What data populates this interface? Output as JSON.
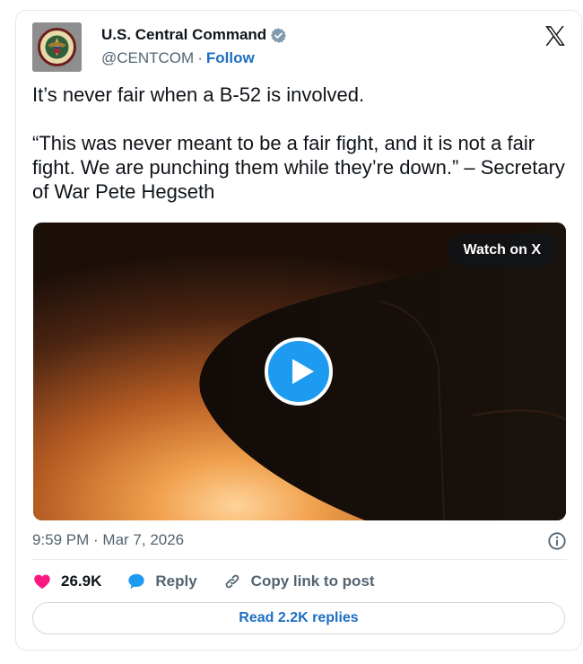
{
  "author": {
    "display_name": "U.S. Central Command",
    "handle": "@CENTCOM",
    "separator": "·",
    "follow_label": "Follow"
  },
  "tweet": {
    "line1": "It’s never fair when a B-52 is involved.",
    "line2": "“This was never meant to be a fair fight, and it is not a fair fight. We are punching them while they’re down.” – Secretary of War Pete Hegseth"
  },
  "media": {
    "watch_label": "Watch on X"
  },
  "timestamp": "9:59 PM · Mar 7, 2026",
  "actions": {
    "likes": "26.9K",
    "reply_label": "Reply",
    "copy_label": "Copy link to post"
  },
  "read_replies_label": "Read 2.2K replies",
  "icons": {
    "verified": "verified-badge-icon",
    "x_logo": "x-logo-icon",
    "play": "play-icon",
    "info": "info-icon",
    "like": "heart-icon",
    "reply": "speech-bubble-icon",
    "copy": "link-icon"
  },
  "colors": {
    "accent": "#1d9bf0",
    "link": "#1d6fc2",
    "like": "#f91880"
  }
}
